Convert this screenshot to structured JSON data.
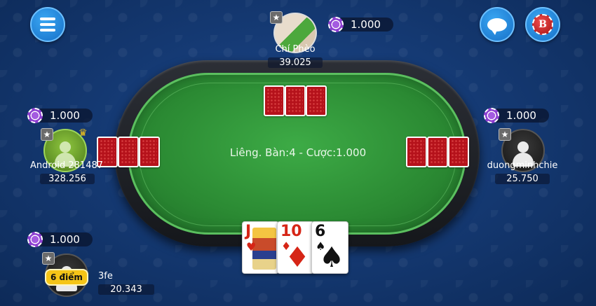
{
  "hud": {
    "menu_icon": "menu-icon",
    "chat_icon": "chat-bubble-icon",
    "bank_icon": "bank-coin-icon",
    "bank_letter": "B"
  },
  "table": {
    "info": "Liêng. Bàn:4 - Cược:1.000",
    "felt_color": "#2b8a33",
    "rail_color": "#1e2026"
  },
  "players": {
    "top": {
      "name": "Chí Phèo",
      "balance": "39.025",
      "bet": "1.000"
    },
    "left": {
      "name": "Android 281487",
      "balance": "328.256",
      "bet": "1.000"
    },
    "right": {
      "name": "duongminhchie",
      "balance": "25.750",
      "bet": "1.000"
    },
    "me": {
      "name": "3fe",
      "balance": "20.343",
      "bet": "1.000",
      "points": "6 điểm"
    }
  },
  "my_cards": [
    {
      "rank": "J",
      "suit": "♥",
      "color": "red"
    },
    {
      "rank": "10",
      "suit": "♦",
      "color": "red"
    },
    {
      "rank": "6",
      "suit": "♠",
      "color": "black"
    }
  ],
  "colors": {
    "chip": "#8d3fd0",
    "accent": "#1670c8",
    "points_badge": "#f5c518"
  }
}
